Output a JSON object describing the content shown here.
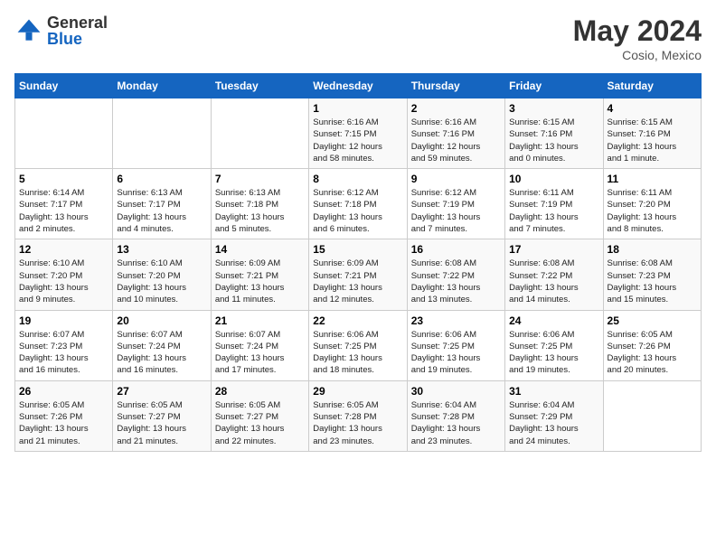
{
  "logo": {
    "general": "General",
    "blue": "Blue"
  },
  "title": {
    "month": "May 2024",
    "location": "Cosio, Mexico"
  },
  "weekdays": [
    "Sunday",
    "Monday",
    "Tuesday",
    "Wednesday",
    "Thursday",
    "Friday",
    "Saturday"
  ],
  "weeks": [
    [
      {
        "day": "",
        "info": ""
      },
      {
        "day": "",
        "info": ""
      },
      {
        "day": "",
        "info": ""
      },
      {
        "day": "1",
        "info": "Sunrise: 6:16 AM\nSunset: 7:15 PM\nDaylight: 12 hours\nand 58 minutes."
      },
      {
        "day": "2",
        "info": "Sunrise: 6:16 AM\nSunset: 7:16 PM\nDaylight: 12 hours\nand 59 minutes."
      },
      {
        "day": "3",
        "info": "Sunrise: 6:15 AM\nSunset: 7:16 PM\nDaylight: 13 hours\nand 0 minutes."
      },
      {
        "day": "4",
        "info": "Sunrise: 6:15 AM\nSunset: 7:16 PM\nDaylight: 13 hours\nand 1 minute."
      }
    ],
    [
      {
        "day": "5",
        "info": "Sunrise: 6:14 AM\nSunset: 7:17 PM\nDaylight: 13 hours\nand 2 minutes."
      },
      {
        "day": "6",
        "info": "Sunrise: 6:13 AM\nSunset: 7:17 PM\nDaylight: 13 hours\nand 4 minutes."
      },
      {
        "day": "7",
        "info": "Sunrise: 6:13 AM\nSunset: 7:18 PM\nDaylight: 13 hours\nand 5 minutes."
      },
      {
        "day": "8",
        "info": "Sunrise: 6:12 AM\nSunset: 7:18 PM\nDaylight: 13 hours\nand 6 minutes."
      },
      {
        "day": "9",
        "info": "Sunrise: 6:12 AM\nSunset: 7:19 PM\nDaylight: 13 hours\nand 7 minutes."
      },
      {
        "day": "10",
        "info": "Sunrise: 6:11 AM\nSunset: 7:19 PM\nDaylight: 13 hours\nand 7 minutes."
      },
      {
        "day": "11",
        "info": "Sunrise: 6:11 AM\nSunset: 7:20 PM\nDaylight: 13 hours\nand 8 minutes."
      }
    ],
    [
      {
        "day": "12",
        "info": "Sunrise: 6:10 AM\nSunset: 7:20 PM\nDaylight: 13 hours\nand 9 minutes."
      },
      {
        "day": "13",
        "info": "Sunrise: 6:10 AM\nSunset: 7:20 PM\nDaylight: 13 hours\nand 10 minutes."
      },
      {
        "day": "14",
        "info": "Sunrise: 6:09 AM\nSunset: 7:21 PM\nDaylight: 13 hours\nand 11 minutes."
      },
      {
        "day": "15",
        "info": "Sunrise: 6:09 AM\nSunset: 7:21 PM\nDaylight: 13 hours\nand 12 minutes."
      },
      {
        "day": "16",
        "info": "Sunrise: 6:08 AM\nSunset: 7:22 PM\nDaylight: 13 hours\nand 13 minutes."
      },
      {
        "day": "17",
        "info": "Sunrise: 6:08 AM\nSunset: 7:22 PM\nDaylight: 13 hours\nand 14 minutes."
      },
      {
        "day": "18",
        "info": "Sunrise: 6:08 AM\nSunset: 7:23 PM\nDaylight: 13 hours\nand 15 minutes."
      }
    ],
    [
      {
        "day": "19",
        "info": "Sunrise: 6:07 AM\nSunset: 7:23 PM\nDaylight: 13 hours\nand 16 minutes."
      },
      {
        "day": "20",
        "info": "Sunrise: 6:07 AM\nSunset: 7:24 PM\nDaylight: 13 hours\nand 16 minutes."
      },
      {
        "day": "21",
        "info": "Sunrise: 6:07 AM\nSunset: 7:24 PM\nDaylight: 13 hours\nand 17 minutes."
      },
      {
        "day": "22",
        "info": "Sunrise: 6:06 AM\nSunset: 7:25 PM\nDaylight: 13 hours\nand 18 minutes."
      },
      {
        "day": "23",
        "info": "Sunrise: 6:06 AM\nSunset: 7:25 PM\nDaylight: 13 hours\nand 19 minutes."
      },
      {
        "day": "24",
        "info": "Sunrise: 6:06 AM\nSunset: 7:25 PM\nDaylight: 13 hours\nand 19 minutes."
      },
      {
        "day": "25",
        "info": "Sunrise: 6:05 AM\nSunset: 7:26 PM\nDaylight: 13 hours\nand 20 minutes."
      }
    ],
    [
      {
        "day": "26",
        "info": "Sunrise: 6:05 AM\nSunset: 7:26 PM\nDaylight: 13 hours\nand 21 minutes."
      },
      {
        "day": "27",
        "info": "Sunrise: 6:05 AM\nSunset: 7:27 PM\nDaylight: 13 hours\nand 21 minutes."
      },
      {
        "day": "28",
        "info": "Sunrise: 6:05 AM\nSunset: 7:27 PM\nDaylight: 13 hours\nand 22 minutes."
      },
      {
        "day": "29",
        "info": "Sunrise: 6:05 AM\nSunset: 7:28 PM\nDaylight: 13 hours\nand 23 minutes."
      },
      {
        "day": "30",
        "info": "Sunrise: 6:04 AM\nSunset: 7:28 PM\nDaylight: 13 hours\nand 23 minutes."
      },
      {
        "day": "31",
        "info": "Sunrise: 6:04 AM\nSunset: 7:29 PM\nDaylight: 13 hours\nand 24 minutes."
      },
      {
        "day": "",
        "info": ""
      }
    ]
  ]
}
